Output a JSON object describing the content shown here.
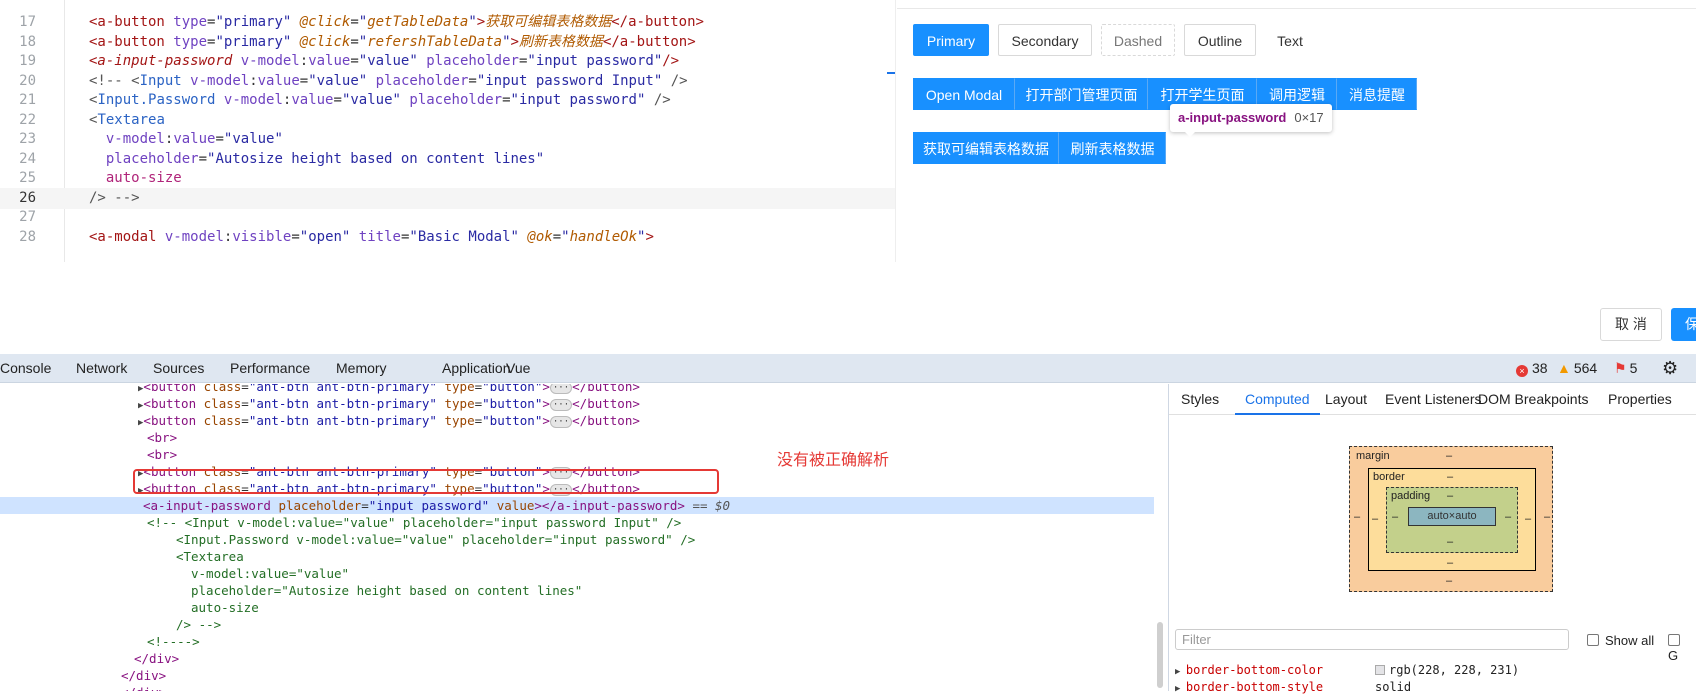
{
  "editor": {
    "lines": [
      {
        "n": "17",
        "html": "<span class=\"tg\">&lt;a-button</span> <span class=\"at\">type</span>=<span class=\"st\">\"primary\"</span> <span class=\"ev\">@click</span>=<span class=\"st\">\"</span><span class=\"ev\">getTableData</span><span class=\"st\">\"</span><span class=\"tg\">&gt;</span><span class=\"ev\">获取可编辑表格数据</span><span class=\"tg\">&lt;/a-button&gt;</span>"
      },
      {
        "n": "18",
        "html": "<span class=\"tg\">&lt;a-button</span> <span class=\"at\">type</span>=<span class=\"st\">\"primary\"</span> <span class=\"ev\">@click</span>=<span class=\"st\">\"</span><span class=\"ev\">refershTableData</span><span class=\"st\">\"</span><span class=\"tg\">&gt;</span><span class=\"ev\">刷新表格数据</span><span class=\"tg\">&lt;/a-button&gt;</span>"
      },
      {
        "n": "19",
        "html": "<span class=\"tg\" style=\"font-style:italic\">&lt;a-input-password</span> <span class=\"at\">v-model</span>:<span class=\"at\">value</span>=<span class=\"st\">\"value\"</span> <span class=\"at\">placeholder</span>=<span class=\"st\">\"input password\"</span><span class=\"tg\">/&gt;</span>"
      },
      {
        "n": "20",
        "html": "<span class=\"cm\">&lt;!-- &lt;</span><span class=\"tc\">Input</span> <span class=\"at\">v-model</span>:<span class=\"at\">value</span>=<span class=\"st\">\"value\"</span> <span class=\"at\">placeholder</span>=<span class=\"st\">\"input password Input\"</span> <span class=\"cm\">/&gt;</span>"
      },
      {
        "n": "21",
        "html": "<span class=\"cm\">&lt;</span><span class=\"tc\">Input.Password</span> <span class=\"at\">v-model</span>:<span class=\"at\">value</span>=<span class=\"st\">\"value\"</span> <span class=\"at\">placeholder</span>=<span class=\"st\">\"input password\"</span> <span class=\"cm\">/&gt;</span>"
      },
      {
        "n": "22",
        "html": "<span class=\"cm\">&lt;</span><span class=\"tc\">Textarea</span>"
      },
      {
        "n": "23",
        "html": "  <span class=\"at\">v-model</span>:<span class=\"at\">value</span>=<span class=\"st\">\"value\"</span>"
      },
      {
        "n": "24",
        "html": "  <span class=\"at\">placeholder</span>=<span class=\"st\">\"Autosize height based on content lines\"</span>"
      },
      {
        "n": "25",
        "html": "  <span class=\"pk\">auto-size</span>"
      },
      {
        "n": "26",
        "html": "<span class=\"cm\">/&gt; --&gt;</span>"
      },
      {
        "n": "27",
        "html": ""
      },
      {
        "n": "28",
        "html": "<span class=\"tg\">&lt;a-modal</span> <span class=\"at\">v-model</span>:<span class=\"at\">visible</span>=<span class=\"st\">\"open\"</span> <span class=\"at\">title</span>=<span class=\"st\">\"Basic Modal\"</span> <span class=\"ev\">@ok</span>=<span class=\"st\">\"</span><span class=\"ev\">handleOk</span><span class=\"st\">\"</span><span class=\"tg\">&gt;</span>"
      }
    ]
  },
  "preview": {
    "row1": [
      "Primary",
      "Secondary",
      "Dashed",
      "Outline",
      "Text"
    ],
    "row2": [
      "Open Modal",
      "打开部门管理页面",
      "打开学生页面",
      "调用逻辑",
      "消息提醒"
    ],
    "row3": [
      "获取可编辑表格数据",
      "刷新表格数据"
    ],
    "tooltip": {
      "name": "a-input-password",
      "dims": "0×17"
    }
  },
  "actions": {
    "cancel": "取 消",
    "save": "保"
  },
  "devtools": {
    "tabs": [
      "Console",
      "Network",
      "Sources",
      "Performance",
      "Memory",
      "Application",
      "Vue"
    ],
    "errors": "38",
    "warnings": "564",
    "issues": "5",
    "annotation": "没有被正确解析",
    "side_tabs": [
      "Styles",
      "Computed",
      "Layout",
      "Event Listeners",
      "DOM Breakpoints",
      "Properties"
    ],
    "box_model": {
      "margin": "margin",
      "border": "border",
      "padding": "padding",
      "content": "auto×auto",
      "dash": "–"
    },
    "filter_placeholder": "Filter",
    "show_all": "Show all",
    "group": "G",
    "properties": [
      {
        "name": "border-bottom-color",
        "value": "rgb(228, 228, 231)"
      },
      {
        "name": "border-bottom-style",
        "value": "solid"
      }
    ]
  },
  "colors": {
    "primary": "#1890ff",
    "error": "#e53935",
    "selection": "#cfe3ff"
  }
}
